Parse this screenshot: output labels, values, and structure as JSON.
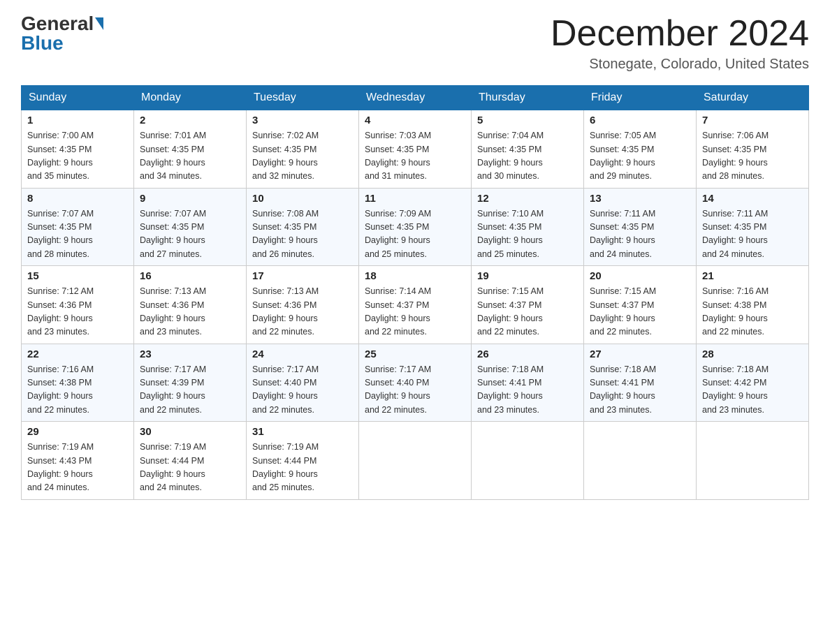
{
  "header": {
    "logo_general": "General",
    "logo_blue": "Blue",
    "month_title": "December 2024",
    "location": "Stonegate, Colorado, United States"
  },
  "days_of_week": [
    "Sunday",
    "Monday",
    "Tuesday",
    "Wednesday",
    "Thursday",
    "Friday",
    "Saturday"
  ],
  "weeks": [
    [
      {
        "day": "1",
        "sunrise": "7:00 AM",
        "sunset": "4:35 PM",
        "daylight": "9 hours and 35 minutes."
      },
      {
        "day": "2",
        "sunrise": "7:01 AM",
        "sunset": "4:35 PM",
        "daylight": "9 hours and 34 minutes."
      },
      {
        "day": "3",
        "sunrise": "7:02 AM",
        "sunset": "4:35 PM",
        "daylight": "9 hours and 32 minutes."
      },
      {
        "day": "4",
        "sunrise": "7:03 AM",
        "sunset": "4:35 PM",
        "daylight": "9 hours and 31 minutes."
      },
      {
        "day": "5",
        "sunrise": "7:04 AM",
        "sunset": "4:35 PM",
        "daylight": "9 hours and 30 minutes."
      },
      {
        "day": "6",
        "sunrise": "7:05 AM",
        "sunset": "4:35 PM",
        "daylight": "9 hours and 29 minutes."
      },
      {
        "day": "7",
        "sunrise": "7:06 AM",
        "sunset": "4:35 PM",
        "daylight": "9 hours and 28 minutes."
      }
    ],
    [
      {
        "day": "8",
        "sunrise": "7:07 AM",
        "sunset": "4:35 PM",
        "daylight": "9 hours and 28 minutes."
      },
      {
        "day": "9",
        "sunrise": "7:07 AM",
        "sunset": "4:35 PM",
        "daylight": "9 hours and 27 minutes."
      },
      {
        "day": "10",
        "sunrise": "7:08 AM",
        "sunset": "4:35 PM",
        "daylight": "9 hours and 26 minutes."
      },
      {
        "day": "11",
        "sunrise": "7:09 AM",
        "sunset": "4:35 PM",
        "daylight": "9 hours and 25 minutes."
      },
      {
        "day": "12",
        "sunrise": "7:10 AM",
        "sunset": "4:35 PM",
        "daylight": "9 hours and 25 minutes."
      },
      {
        "day": "13",
        "sunrise": "7:11 AM",
        "sunset": "4:35 PM",
        "daylight": "9 hours and 24 minutes."
      },
      {
        "day": "14",
        "sunrise": "7:11 AM",
        "sunset": "4:35 PM",
        "daylight": "9 hours and 24 minutes."
      }
    ],
    [
      {
        "day": "15",
        "sunrise": "7:12 AM",
        "sunset": "4:36 PM",
        "daylight": "9 hours and 23 minutes."
      },
      {
        "day": "16",
        "sunrise": "7:13 AM",
        "sunset": "4:36 PM",
        "daylight": "9 hours and 23 minutes."
      },
      {
        "day": "17",
        "sunrise": "7:13 AM",
        "sunset": "4:36 PM",
        "daylight": "9 hours and 22 minutes."
      },
      {
        "day": "18",
        "sunrise": "7:14 AM",
        "sunset": "4:37 PM",
        "daylight": "9 hours and 22 minutes."
      },
      {
        "day": "19",
        "sunrise": "7:15 AM",
        "sunset": "4:37 PM",
        "daylight": "9 hours and 22 minutes."
      },
      {
        "day": "20",
        "sunrise": "7:15 AM",
        "sunset": "4:37 PM",
        "daylight": "9 hours and 22 minutes."
      },
      {
        "day": "21",
        "sunrise": "7:16 AM",
        "sunset": "4:38 PM",
        "daylight": "9 hours and 22 minutes."
      }
    ],
    [
      {
        "day": "22",
        "sunrise": "7:16 AM",
        "sunset": "4:38 PM",
        "daylight": "9 hours and 22 minutes."
      },
      {
        "day": "23",
        "sunrise": "7:17 AM",
        "sunset": "4:39 PM",
        "daylight": "9 hours and 22 minutes."
      },
      {
        "day": "24",
        "sunrise": "7:17 AM",
        "sunset": "4:40 PM",
        "daylight": "9 hours and 22 minutes."
      },
      {
        "day": "25",
        "sunrise": "7:17 AM",
        "sunset": "4:40 PM",
        "daylight": "9 hours and 22 minutes."
      },
      {
        "day": "26",
        "sunrise": "7:18 AM",
        "sunset": "4:41 PM",
        "daylight": "9 hours and 23 minutes."
      },
      {
        "day": "27",
        "sunrise": "7:18 AM",
        "sunset": "4:41 PM",
        "daylight": "9 hours and 23 minutes."
      },
      {
        "day": "28",
        "sunrise": "7:18 AM",
        "sunset": "4:42 PM",
        "daylight": "9 hours and 23 minutes."
      }
    ],
    [
      {
        "day": "29",
        "sunrise": "7:19 AM",
        "sunset": "4:43 PM",
        "daylight": "9 hours and 24 minutes."
      },
      {
        "day": "30",
        "sunrise": "7:19 AM",
        "sunset": "4:44 PM",
        "daylight": "9 hours and 24 minutes."
      },
      {
        "day": "31",
        "sunrise": "7:19 AM",
        "sunset": "4:44 PM",
        "daylight": "9 hours and 25 minutes."
      },
      null,
      null,
      null,
      null
    ]
  ],
  "labels": {
    "sunrise": "Sunrise:",
    "sunset": "Sunset:",
    "daylight": "Daylight:"
  }
}
